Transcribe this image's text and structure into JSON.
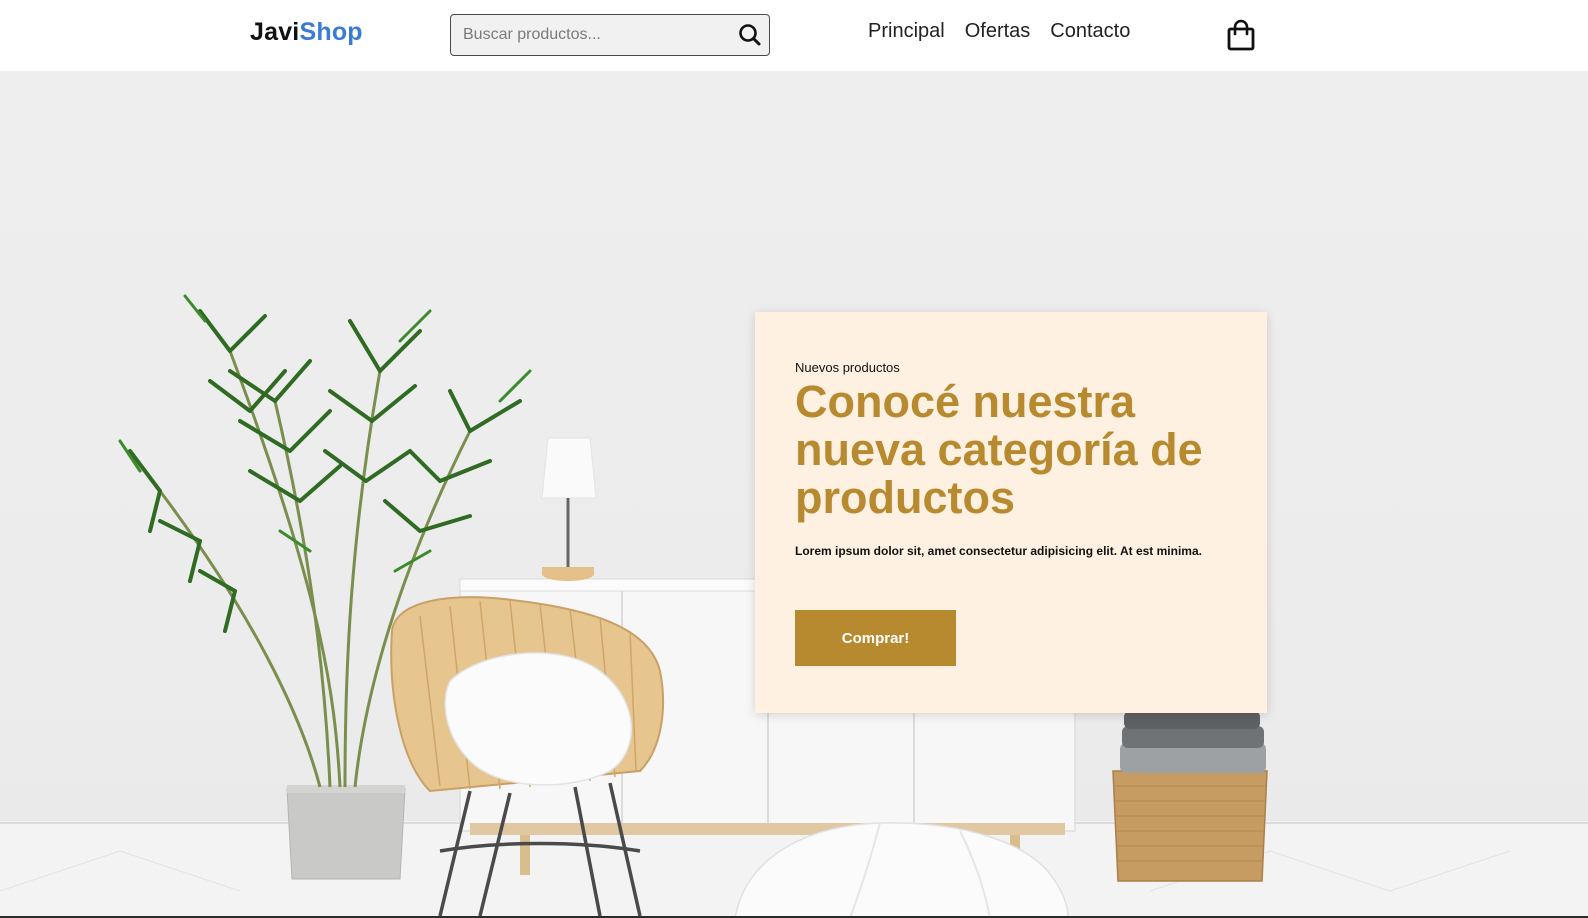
{
  "header": {
    "logo": {
      "part1": "Javi",
      "part2": "Shop"
    },
    "search": {
      "placeholder": "Buscar productos...",
      "value": ""
    },
    "nav": [
      "Principal",
      "Ofertas",
      "Contacto"
    ]
  },
  "hero": {
    "eyebrow": "Nuevos productos",
    "headline": "Conocé nuestra nueva categoría de productos",
    "description": "Lorem ipsum dolor sit, amet consectetur adipisicing elit. At est minima.",
    "button": "Comprar!"
  },
  "colors": {
    "brand_accent": "#3a7bd5",
    "gold": "#b88a2f",
    "card_bg": "#fef1e2"
  },
  "icons": [
    "search-icon",
    "shopping-bag-icon"
  ]
}
